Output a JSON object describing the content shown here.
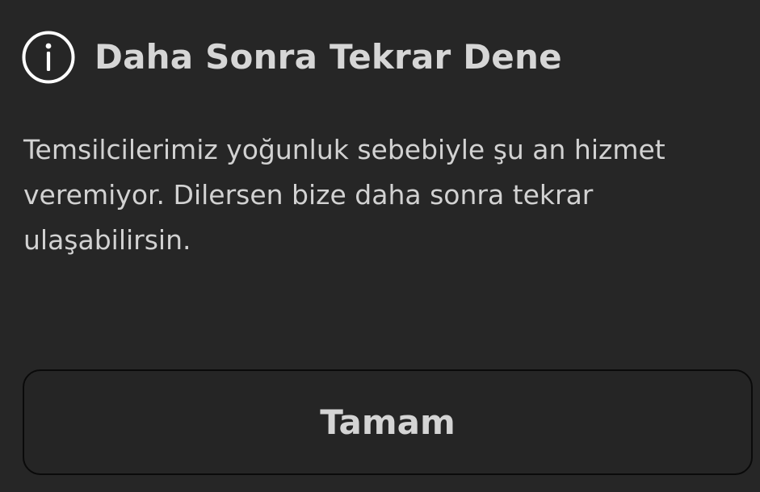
{
  "dialog": {
    "icon": "info-icon",
    "title": "Daha Sonra Tekrar Dene",
    "message": "Temsilcilerimiz yoğunluk sebebiyle şu an hizmet veremiyor. Dilersen bize daha sonra tekrar ulaşabilirsin.",
    "ok_label": "Tamam"
  },
  "colors": {
    "background": "#262626",
    "text": "#d4d4d4",
    "button_border": "#0a0a0a"
  }
}
